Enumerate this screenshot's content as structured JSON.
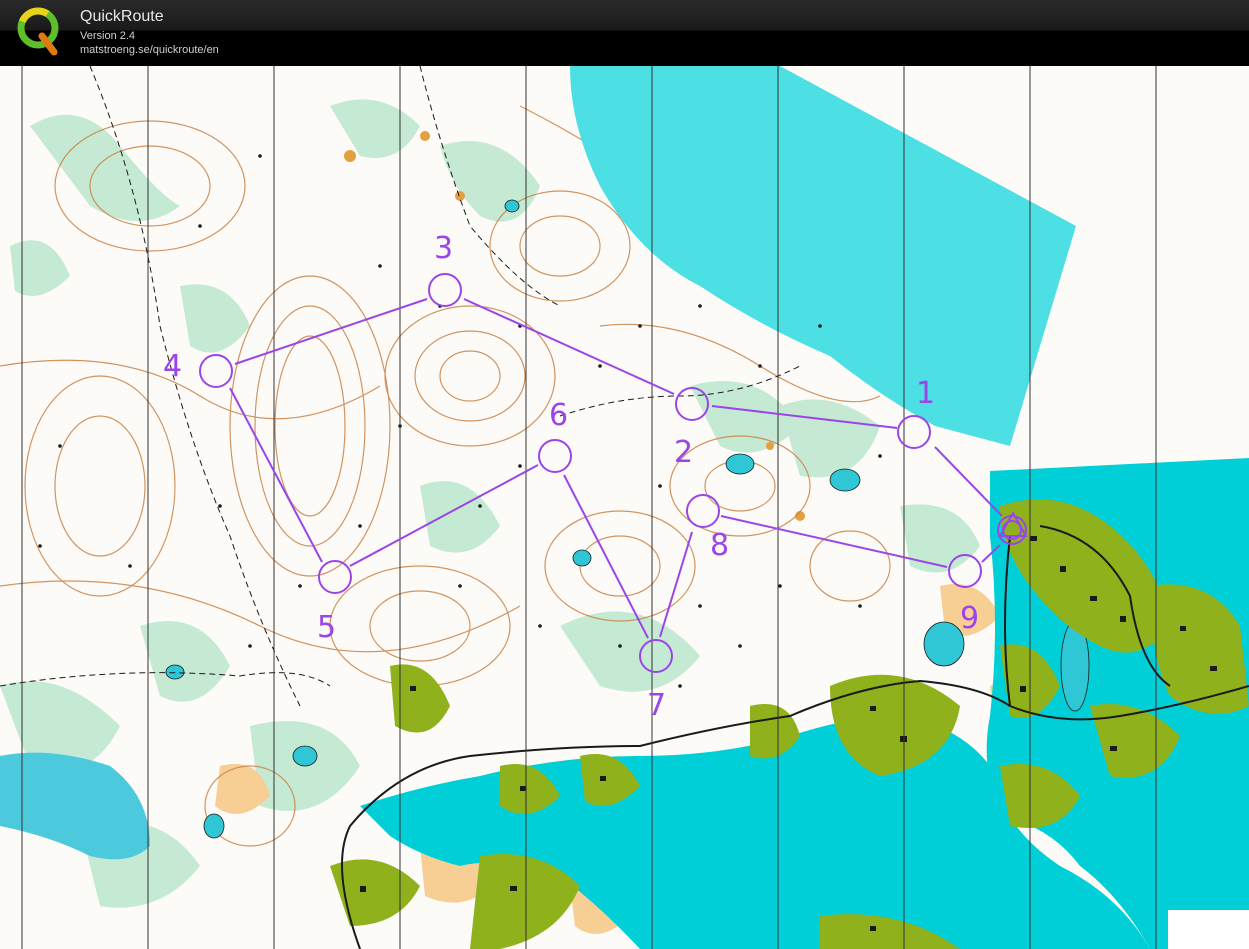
{
  "app": {
    "title": "QuickRoute",
    "version": "Version 2.4",
    "url": "matstroeng.se/quickroute/en"
  },
  "colors": {
    "water": "#4cdfe3",
    "sea": "#00cfd8",
    "course": "#9b45e8",
    "forest_open": "#ffffff",
    "vegetation_light": "#bfe8c8",
    "settlement": "#8fb21c",
    "open_land": "#f5c98a",
    "contour": "#c47a3a",
    "meridian": "#333333"
  },
  "course": {
    "controls": [
      {
        "label": "1"
      },
      {
        "label": "2"
      },
      {
        "label": "3"
      },
      {
        "label": "4"
      },
      {
        "label": "5"
      },
      {
        "label": "6"
      },
      {
        "label": "7"
      },
      {
        "label": "8"
      },
      {
        "label": "9"
      }
    ]
  }
}
